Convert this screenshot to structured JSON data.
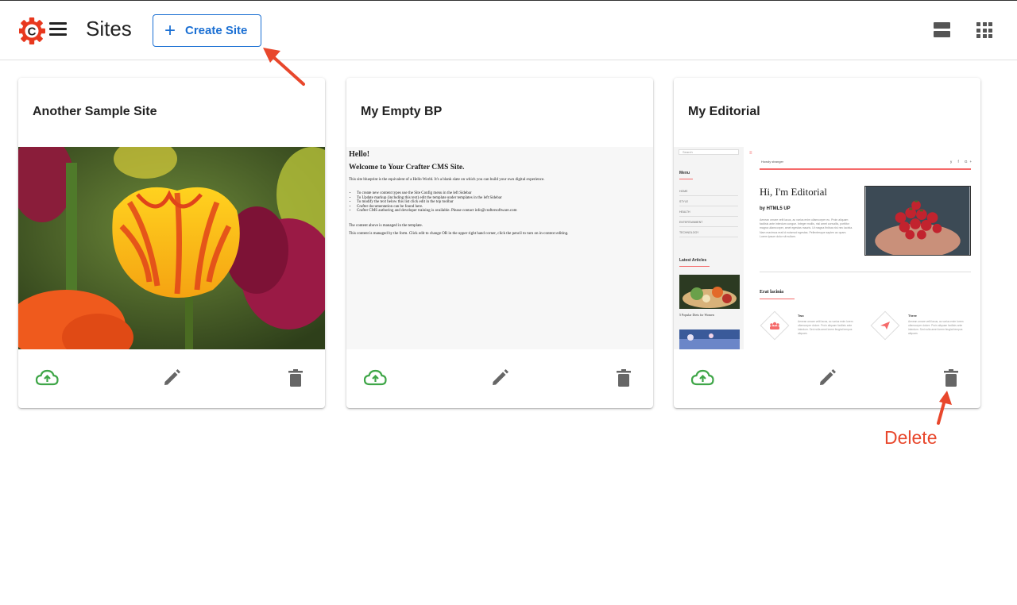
{
  "header": {
    "title": "Sites",
    "create_button_label": "Create Site",
    "logo_letter": "C",
    "brand_color": "#e8381e",
    "accent_color": "#1a6fd3"
  },
  "icons": {
    "menu": "hamburger-menu-icon",
    "list_view": "list-view-icon",
    "grid_view": "grid-view-icon",
    "publish": "cloud-upload-icon",
    "edit": "pencil-icon",
    "delete": "trash-icon"
  },
  "sites": [
    {
      "name": "Another Sample Site",
      "preview": "tulip-photo"
    },
    {
      "name": "My Empty BP",
      "preview_content": {
        "heading": "Hello!",
        "subheading": "Welcome to Your Crafter CMS Site.",
        "intro": "This site blueprint is the equivalent of a Hello World. It's a blank slate on which you can build your own digital experience.",
        "bullets": [
          "To create new content types use the Site Config menu in the left Sidebar",
          "To Update markup (including this text) edit the template under templates in the left Sidebar",
          "To modify the text below this list click edit in the top toolbar",
          "Crafter documentation can be found here.",
          "Crafter CMS authoring and developer training is available. Please contact info@craftersoftware.com"
        ],
        "para1": "The content above is managed in the template.",
        "para2": "This content is managed by the form.  Click edit to change OR in the upper right hand corner, click the pencil to turn on in-context editing."
      }
    },
    {
      "name": "My Editorial",
      "preview_content": {
        "search_placeholder": "Search",
        "menu_heading": "Menu",
        "menu_items": [
          "HOME",
          "STYLE",
          "HEALTH",
          "ENTERTAINMENT",
          "TECHNOLOGY"
        ],
        "latest_heading": "Latest Articles",
        "latest_caption": "5 Popular Diets for Women",
        "brand": "Howdy stranger",
        "social": "y f G+",
        "hero_title": "Hi, I'm Editorial",
        "hero_subtitle": "by HTML5 UP",
        "hero_body": "Aenean ornare velit lacus, ac varius enim ullamcorper eu. Proin aliquam facilisis ante interdum congue. Integer mollis, nisl amet convallis, porttitor magna ullamcorper, amet egestas mauris. Ut magna finibus nisi nec lacinia. Nam maximus erat id euismod egestas. Pellentesque sapien ac quam. Lorem ipsum dolor sit nullam.",
        "section_title": "Erat lacinia",
        "features": [
          {
            "title": "Two",
            "body": "Aenean ornare velit lacus, ac varius enim lorem ullamcorper dolore. Proin aliquam facilisis ante interdum. Sed nulla amet lorem feugiat tempus aliquam."
          },
          {
            "title": "Three",
            "body": "Aenean ornare velit lacus, ac varius enim lorem ullamcorper dolore. Proin aliquam facilisis ante interdum. Sed nulla amet lorem feugiat tempus aliquam."
          }
        ]
      }
    }
  ],
  "annotations": {
    "delete_label": "Delete",
    "color": "#e8472c"
  }
}
